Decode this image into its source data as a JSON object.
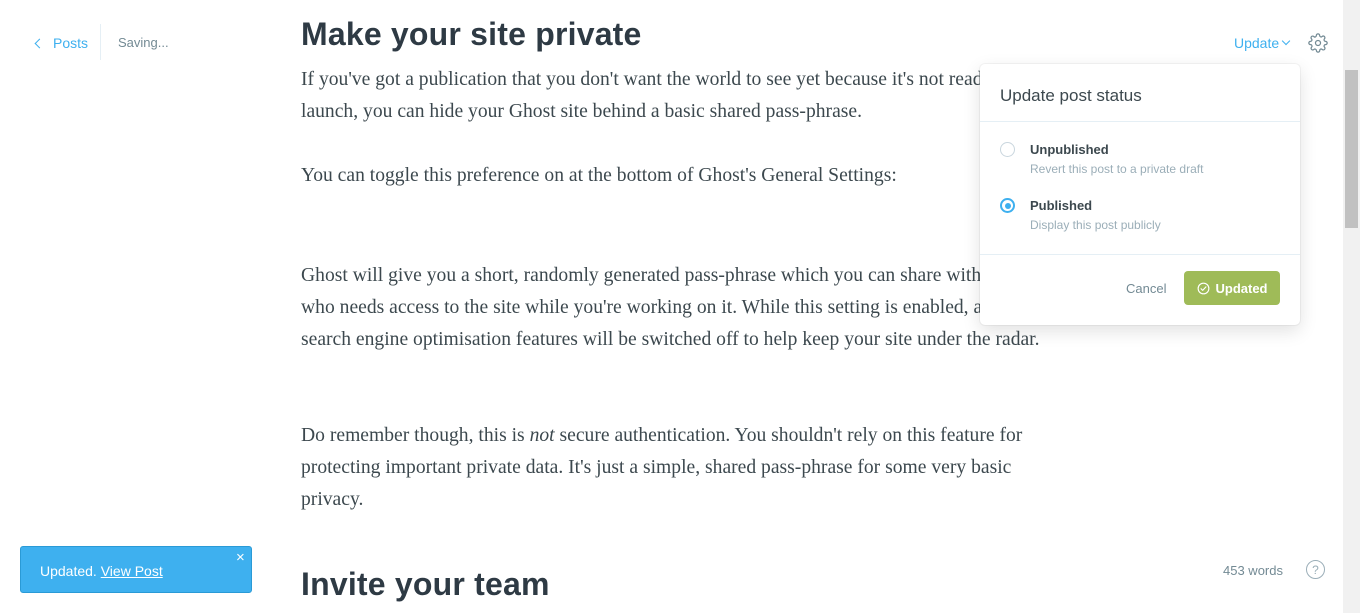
{
  "nav": {
    "back_label": "Posts",
    "status_text": "Saving..."
  },
  "header": {
    "update_label": "Update",
    "settings_icon": "gear-icon"
  },
  "article": {
    "heading_1": "Make your site private",
    "p1": "If you've got a publication that you don't want the world to see yet because it's not ready to launch, you can hide your Ghost site behind a basic shared pass-phrase.",
    "p2": "You can toggle this preference on at the bottom of Ghost's General Settings:",
    "p3": "Ghost will give you a short, randomly generated pass-phrase which you can share with anyone who needs access to the site while you're working on it. While this setting is enabled, all search engine optimisation features will be switched off to help keep your site under the radar.",
    "p4_before": "Do remember though, this is ",
    "p4_em": "not",
    "p4_after": " secure authentication. You shouldn't rely on this feature for protecting important private data. It's just a simple, shared pass-phrase for some very basic privacy.",
    "heading_2": "Invite your team"
  },
  "popover": {
    "title": "Update post status",
    "options": [
      {
        "label": "Unpublished",
        "description": "Revert this post to a private draft",
        "checked": false
      },
      {
        "label": "Published",
        "description": "Display this post publicly",
        "checked": true
      }
    ],
    "cancel_label": "Cancel",
    "confirm_label": "Updated"
  },
  "toast": {
    "message": "Updated.",
    "link_label": "View Post",
    "close_glyph": "×"
  },
  "footer": {
    "word_count": "453 words",
    "help_glyph": "?"
  },
  "colors": {
    "accent": "#3eb0ef",
    "success": "#9fbb58"
  }
}
